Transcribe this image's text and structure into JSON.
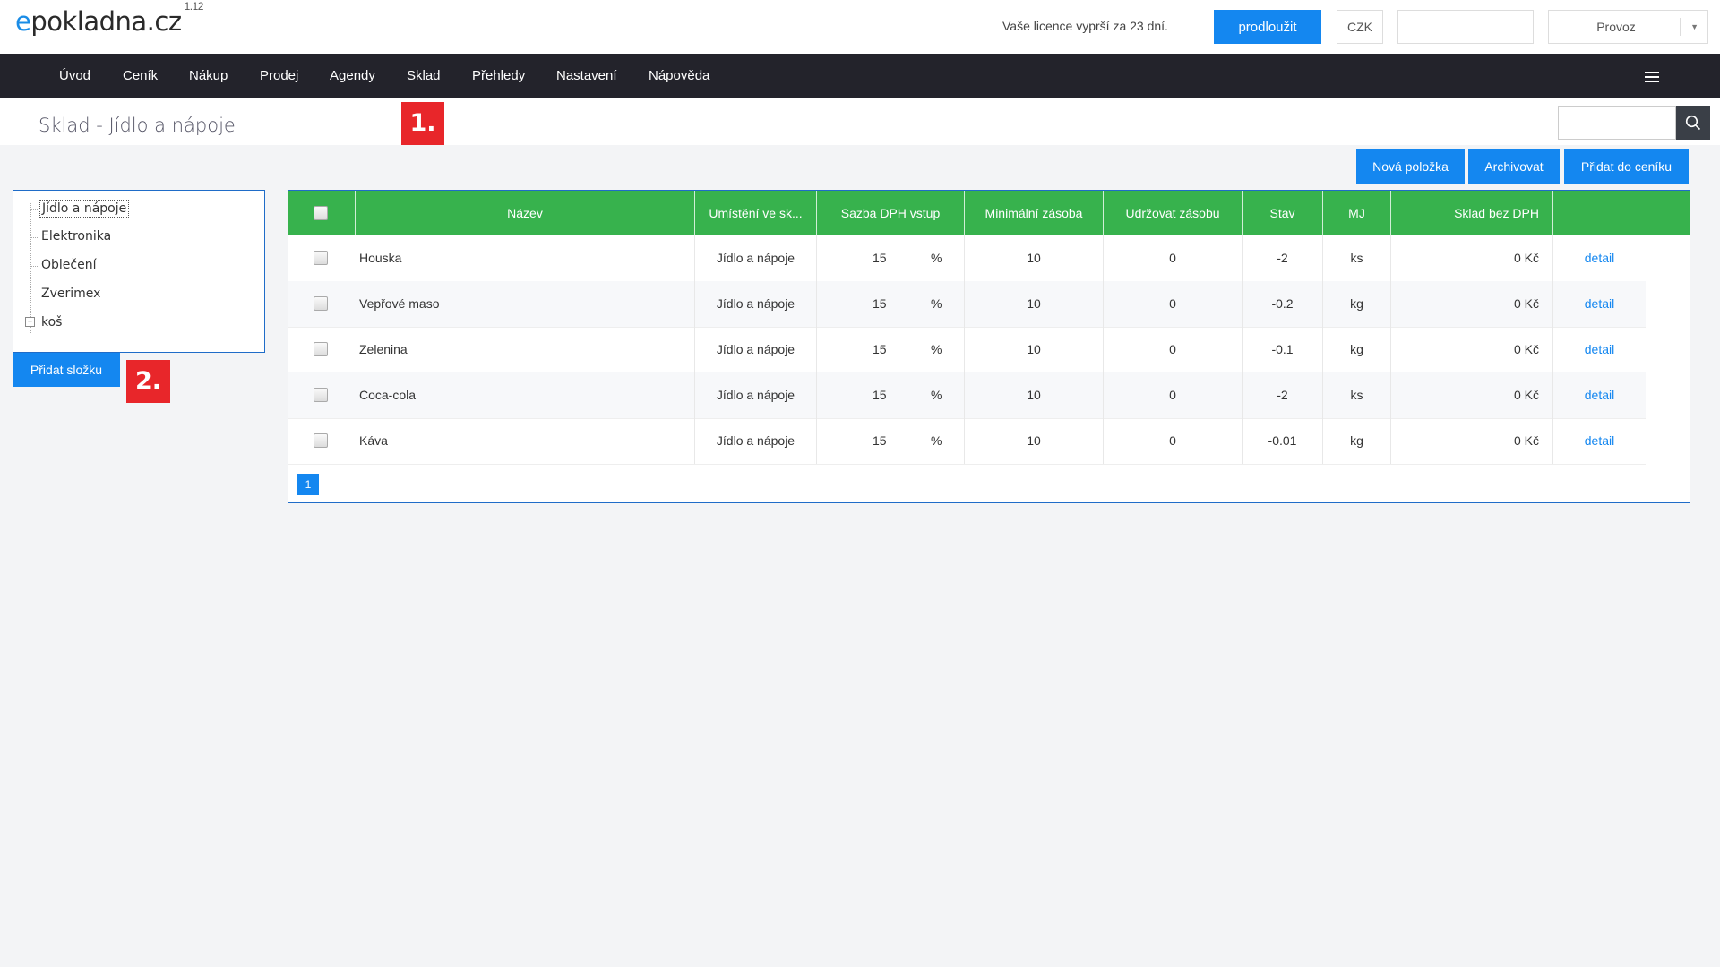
{
  "app": {
    "logo_prefix": "e",
    "logo_rest": "pokladna.cz",
    "version": "1.12"
  },
  "header": {
    "license_text": "Vaše licence vyprší za 23 dní.",
    "extend_button": "prodloužit",
    "currency": "CZK",
    "mode_select": "Provoz"
  },
  "nav": {
    "items": [
      "Úvod",
      "Ceník",
      "Nákup",
      "Prodej",
      "Agendy",
      "Sklad",
      "Přehledy",
      "Nastavení",
      "Nápověda"
    ]
  },
  "page": {
    "title": "Sklad - Jídlo a nápoje",
    "marker1": "1.",
    "marker2": "2."
  },
  "tree": {
    "items": [
      "Jídlo a nápoje",
      "Elektronika",
      "Oblečení",
      "Zverimex",
      "koš"
    ],
    "add_folder_button": "Přidat složku"
  },
  "toolbar": {
    "new_item": "Nová položka",
    "archive": "Archivovat",
    "add_to_pricelist": "Přidat do ceníku"
  },
  "table": {
    "columns": [
      "Název",
      "Umístění ve sk...",
      "Sazba DPH vstup",
      "Minimální zásoba",
      "Udržovat zásobu",
      "Stav",
      "MJ",
      "Sklad bez DPH"
    ],
    "rows": [
      {
        "name": "Houska",
        "location": "Jídlo a nápoje",
        "vat": "15",
        "vat_unit": "%",
        "min_stock": "10",
        "keep_stock": "0",
        "state": "-2",
        "unit": "ks",
        "stock_value": "0 Kč",
        "action": "detail"
      },
      {
        "name": "Vepřové maso",
        "location": "Jídlo a nápoje",
        "vat": "15",
        "vat_unit": "%",
        "min_stock": "10",
        "keep_stock": "0",
        "state": "-0.2",
        "unit": "kg",
        "stock_value": "0 Kč",
        "action": "detail"
      },
      {
        "name": "Zelenina",
        "location": "Jídlo a nápoje",
        "vat": "15",
        "vat_unit": "%",
        "min_stock": "10",
        "keep_stock": "0",
        "state": "-0.1",
        "unit": "kg",
        "stock_value": "0 Kč",
        "action": "detail"
      },
      {
        "name": "Coca-cola",
        "location": "Jídlo a nápoje",
        "vat": "15",
        "vat_unit": "%",
        "min_stock": "10",
        "keep_stock": "0",
        "state": "-2",
        "unit": "ks",
        "stock_value": "0 Kč",
        "action": "detail"
      },
      {
        "name": "Káva",
        "location": "Jídlo a nápoje",
        "vat": "15",
        "vat_unit": "%",
        "min_stock": "10",
        "keep_stock": "0",
        "state": "-0.01",
        "unit": "kg",
        "stock_value": "0 Kč",
        "action": "detail"
      }
    ],
    "page": "1"
  },
  "colors": {
    "primary": "#1487f0",
    "header_green": "#37b24d",
    "nav_dark": "#23232b",
    "marker_red": "#e8262a"
  }
}
